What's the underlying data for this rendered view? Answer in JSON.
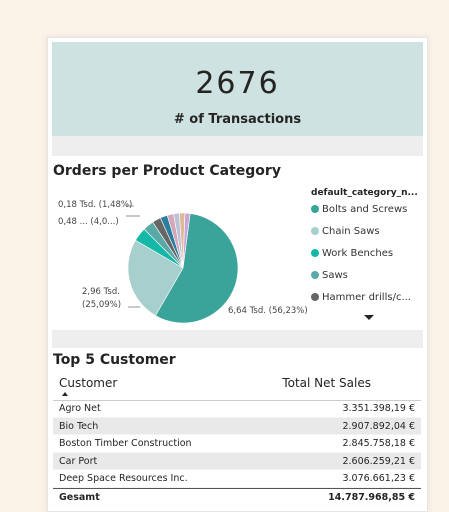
{
  "kpi": {
    "value": "2676",
    "label": "# of Transactions"
  },
  "pie": {
    "title": "Orders per Product Category",
    "legend_title": "default_category_n...",
    "legend": [
      {
        "label": "Bolts and Screws",
        "color": "#3aa39a"
      },
      {
        "label": "Chain Saws",
        "color": "#a6cfcd"
      },
      {
        "label": "Work Benches",
        "color": "#14b8a6"
      },
      {
        "label": "Saws",
        "color": "#5aa9a9"
      },
      {
        "label": "Hammer drills/c...",
        "color": "#666666"
      }
    ],
    "data_labels": [
      "0,18 Tsd. (1,48%)",
      "0,48 ... (4,0...)",
      "2,96 Tsd.",
      "(25,09%)",
      "6,64 Tsd. (56,23%)"
    ]
  },
  "chart_data": {
    "type": "pie",
    "title": "Orders per Product Category",
    "legend_title": "default_category_n...",
    "slices": [
      {
        "label": "Bolts and Screws",
        "value": 6.64,
        "percent": 56.23,
        "color": "#3aa39a"
      },
      {
        "label": "Chain Saws",
        "value": 2.96,
        "percent": 25.09,
        "color": "#a6cfcd"
      },
      {
        "label": "Work Benches",
        "value": 0.48,
        "percent": 4.0,
        "color": "#14b8a6"
      },
      {
        "label": "Saws",
        "value": 0.38,
        "percent": 3.2,
        "color": "#5aa9a9"
      },
      {
        "label": "Hammer drills/c...",
        "value": 0.3,
        "percent": 2.5,
        "color": "#666666"
      },
      {
        "label": "",
        "value": 0.25,
        "percent": 2.1,
        "color": "#2a7f9e"
      },
      {
        "label": "",
        "value": 0.22,
        "percent": 1.9,
        "color": "#d4a6b8"
      },
      {
        "label": "",
        "value": 0.2,
        "percent": 1.7,
        "color": "#b8c4d6"
      },
      {
        "label": "",
        "value": 0.19,
        "percent": 1.6,
        "color": "#e0b89a"
      },
      {
        "label": "",
        "value": 0.18,
        "percent": 1.48,
        "color": "#c9a6d4"
      }
    ]
  },
  "table": {
    "title": "Top 5 Customer",
    "col_customer": "Customer",
    "col_sales": "Total Net Sales",
    "rows": [
      {
        "customer": "Agro Net",
        "sales": "3.351.398,19 €"
      },
      {
        "customer": "Bio Tech",
        "sales": "2.907.892,04 €"
      },
      {
        "customer": "Boston Timber Construction",
        "sales": "2.845.758,18 €"
      },
      {
        "customer": "Car Port",
        "sales": "2.606.259,21 €"
      },
      {
        "customer": "Deep Space Resources Inc.",
        "sales": "3.076.661,23 €"
      }
    ],
    "total": {
      "label": "Gesamt",
      "sales": "14.787.968,85 €"
    }
  }
}
